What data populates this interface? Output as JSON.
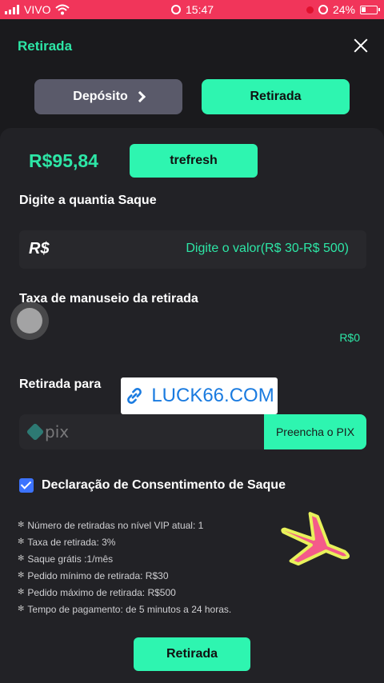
{
  "statusbar": {
    "carrier": "VIVO",
    "time": "15:47",
    "battery": "24%"
  },
  "header": {
    "title": "Retirada"
  },
  "tabs": {
    "deposit_label": "Depósito",
    "withdraw_label": "Retirada"
  },
  "balance": {
    "amount": "R$95,84",
    "refresh_label": "trefresh"
  },
  "amount_section": {
    "label": "Digite a quantia Saque",
    "currency_symbol": "R$",
    "placeholder": "Digite o valor(R$ 30-R$ 500)"
  },
  "fee_section": {
    "label": "Taxa de manuseio da retirada",
    "value": "R$0"
  },
  "withdraw_to": {
    "label": "Retirada para",
    "banner_text": "LUCK66.COM",
    "pix_logo_text": "pix",
    "pix_button_label": "Preencha o PIX"
  },
  "consent": {
    "label": "Declaração de Consentimento de Saque",
    "checked": true
  },
  "info_items": [
    "Número de retiradas no nível VIP atual: 1",
    "Taxa de retirada: 3%",
    "Saque grátis :1/mês",
    "Pedido mínimo de retirada: R$30",
    "Pedido máximo de retirada: R$500",
    "Tempo de pagamento: de 5 minutos a 24 horas."
  ],
  "submit": {
    "label": "Retirada"
  },
  "colors": {
    "accent": "#2ef5b0",
    "accent_text": "#2de6a6",
    "statusbar": "#f1355a",
    "background": "#1a1a1d",
    "checkbox": "#3c73ff"
  }
}
